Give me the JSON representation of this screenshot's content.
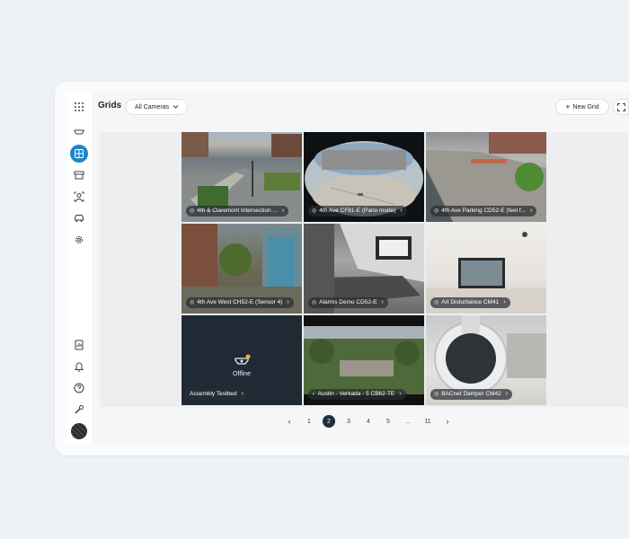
{
  "header": {
    "title": "Grids",
    "filter_label": "All Cameras",
    "new_grid_label": "New Grid"
  },
  "sidebar": {
    "items": [
      {
        "name": "apps-grid-icon"
      },
      {
        "name": "camera-icon"
      },
      {
        "name": "grids-icon",
        "active": true
      },
      {
        "name": "archive-icon"
      },
      {
        "name": "people-icon"
      },
      {
        "name": "vehicle-icon"
      },
      {
        "name": "settings-icon"
      },
      {
        "name": "reports-icon"
      },
      {
        "name": "bell-icon"
      },
      {
        "name": "help-icon"
      },
      {
        "name": "tools-icon"
      }
    ],
    "active_color": "#1c86c9"
  },
  "tiles": [
    {
      "label": "4th & Claremont Intersection ...",
      "status_icon": "camera-icon"
    },
    {
      "label": "4th Ave CF81-E (Pano mode)",
      "status_icon": "camera-icon"
    },
    {
      "label": "4th Ave Parking CD52-E (feel f...",
      "status_icon": "camera-icon"
    },
    {
      "label": "4th Ave West CH52-E (Sensor 4)",
      "status_icon": "camera-icon"
    },
    {
      "label": "Alarms Demo CD52-E",
      "status_icon": "camera-icon"
    },
    {
      "label": "Art Disturbance CM41",
      "status_icon": "camera-icon"
    },
    {
      "label": "Assembly Testbed",
      "status_icon": "",
      "offline_text": "Offline"
    },
    {
      "label": "Austin - Verkada - 5 CB62-TE",
      "status_icon": "green-dot-icon"
    },
    {
      "label": "BACnet Damper CM42",
      "status_icon": "camera-icon"
    }
  ],
  "pagination": {
    "pages": [
      "1",
      "2",
      "3",
      "4",
      "5",
      "...",
      "11"
    ],
    "current": "2",
    "prev": "‹",
    "next": "›"
  }
}
